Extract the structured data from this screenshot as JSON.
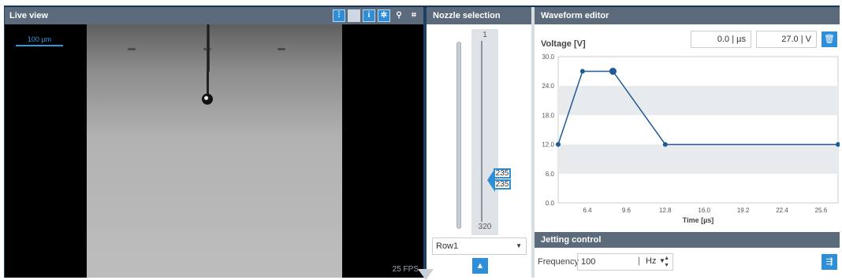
{
  "live_view": {
    "title": "Live view",
    "toolbar": [
      {
        "icon": "sliders-icon"
      },
      {
        "icon": "blank-icon"
      },
      {
        "icon": "info-icon"
      },
      {
        "icon": "settings-icon"
      },
      {
        "icon": "zoom-icon"
      },
      {
        "icon": "fit-frame-icon"
      }
    ],
    "scale_label": "100 µm",
    "fps": "25 FPS"
  },
  "nozzle_selection": {
    "title": "Nozzle selection",
    "range_min": "1",
    "range_max": "320",
    "value_a": "235",
    "value_b": "235",
    "row_select": "Row1",
    "apply_icon": "apply-nozzle-icon"
  },
  "waveform_editor": {
    "title": "Waveform editor",
    "voltage_label": "Voltage [V]",
    "time_field": "0.0",
    "time_unit": "| µs",
    "voltage_field": "27.0",
    "voltage_unit": "| V",
    "delete_icon": "trash-icon"
  },
  "chart_data": {
    "type": "line",
    "title": "",
    "xlabel": "Time [µs]",
    "ylabel": "Voltage [V]",
    "x_ticks": [
      "6.4",
      "9.6",
      "12.8",
      "16.0",
      "19.2",
      "22.4",
      "25.6"
    ],
    "y_ticks": [
      "0.0",
      "6.0",
      "12.0",
      "18.0",
      "24.0",
      "30.0"
    ],
    "xlim": [
      4.0,
      27.0
    ],
    "ylim": [
      0,
      30
    ],
    "series": [
      {
        "points": [
          [
            4.0,
            12.0
          ],
          [
            6.0,
            27.0
          ],
          [
            8.5,
            27.0
          ],
          [
            12.8,
            12.0
          ],
          [
            27.0,
            12.0
          ]
        ]
      }
    ],
    "selected_point_index": 2,
    "bands": [
      [
        6,
        12
      ],
      [
        18,
        24
      ]
    ],
    "line_color": "#1f5a96"
  },
  "jetting_control": {
    "title": "Jetting control",
    "frequency_label": "Frequency",
    "frequency_value": "100",
    "unit_pipe": "|",
    "unit": "Hz",
    "action_icon": "jet-action-icon"
  }
}
